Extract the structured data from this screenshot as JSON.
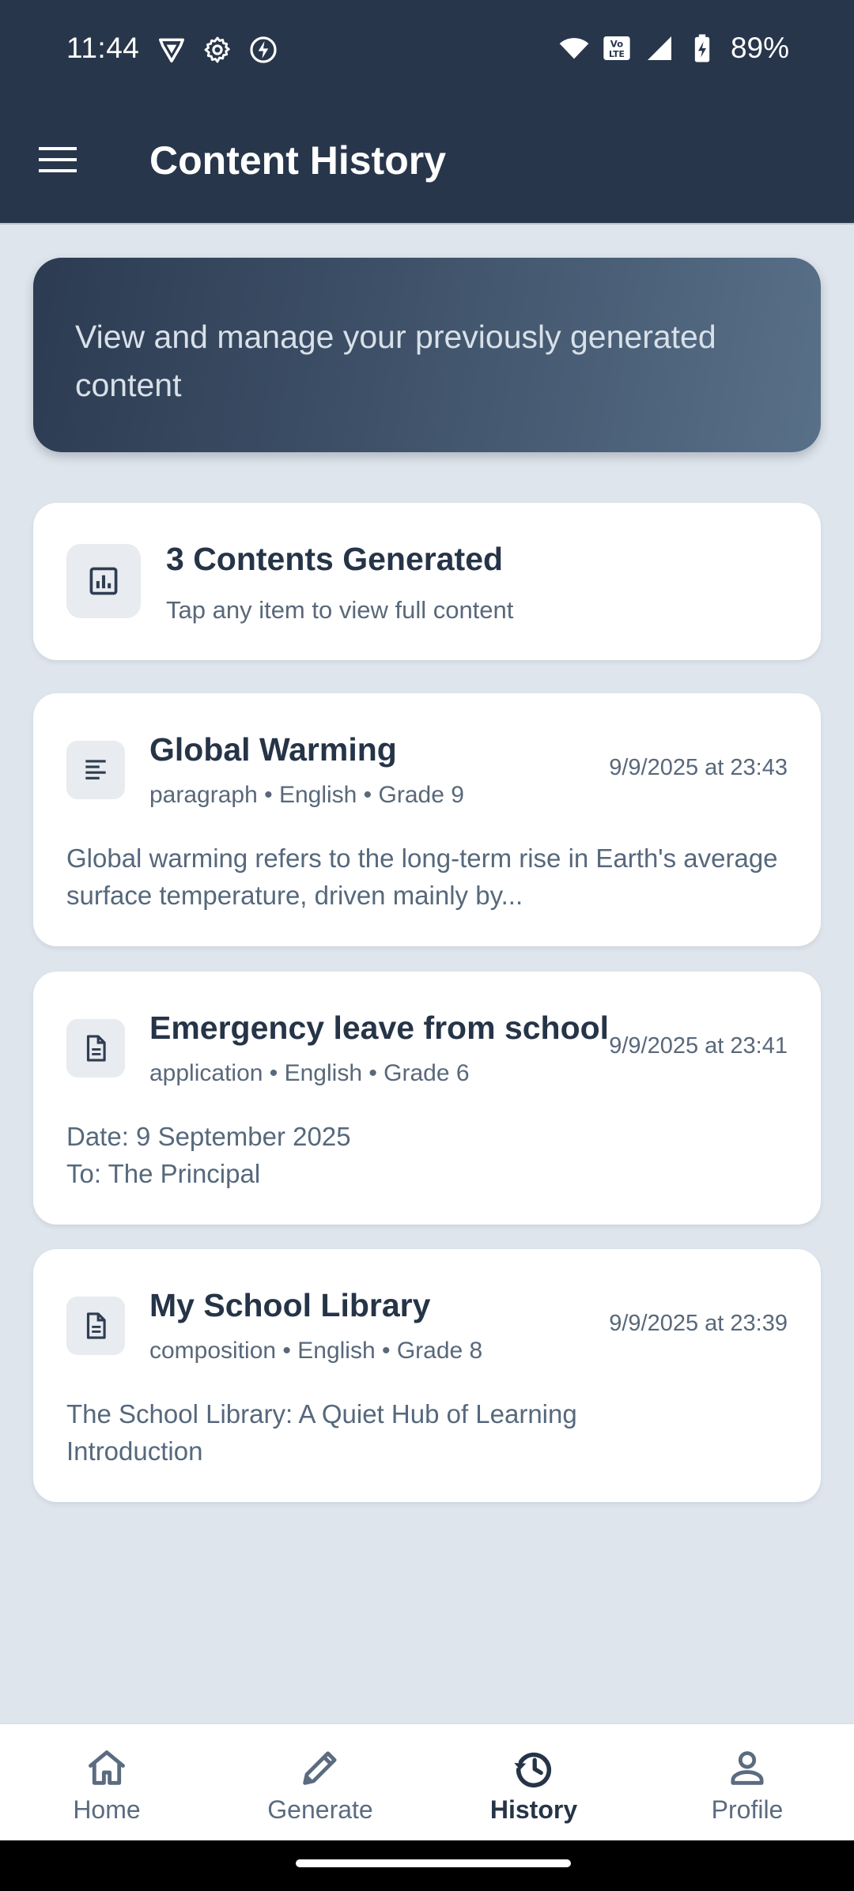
{
  "status_bar": {
    "time": "11:44",
    "battery": "89%",
    "left_icons": [
      "vpn-shield-icon",
      "settings-gear-icon",
      "flash-bolt-icon"
    ],
    "right_icons": [
      "wifi-icon",
      "volte-icon",
      "signal-icon",
      "battery-icon"
    ]
  },
  "app_bar": {
    "title": "Content History",
    "menu_icon": "hamburger-menu-icon"
  },
  "banner": {
    "text": "View and manage your previously generated content"
  },
  "summary": {
    "title": "3 Contents Generated",
    "subtitle": "Tap any item to view full content",
    "icon": "analytics-chart-icon"
  },
  "items": [
    {
      "title": "Global Warming",
      "meta": "paragraph • English • Grade 9",
      "date": "9/9/2025 at 23:43",
      "preview": "Global warming refers to the long-term rise in Earth's average surface temperature, driven mainly by...",
      "icon": "paragraph-lines-icon"
    },
    {
      "title": "Emergency leave from school",
      "meta": "application • English • Grade 6",
      "date": "9/9/2025 at 23:41",
      "preview_line1": "Date: 9 September 2025",
      "preview_line2": "To: The Principal",
      "icon": "document-icon"
    },
    {
      "title": "My School Library",
      "meta": "composition • English • Grade 8",
      "date": "9/9/2025 at 23:39",
      "preview_line1": "The School Library: A Quiet Hub of Learning",
      "preview_line2": "Introduction",
      "icon": "document-icon"
    }
  ],
  "bottom_nav": [
    {
      "label": "Home",
      "icon": "home-icon",
      "active": false
    },
    {
      "label": "Generate",
      "icon": "pencil-icon",
      "active": false
    },
    {
      "label": "History",
      "icon": "history-icon",
      "active": true
    },
    {
      "label": "Profile",
      "icon": "person-icon",
      "active": false
    }
  ],
  "colors": {
    "header_bg": "#28364b",
    "page_bg": "#dfe5ec",
    "card_bg": "#ffffff",
    "primary_text": "#263448",
    "secondary_text": "#59687a"
  }
}
